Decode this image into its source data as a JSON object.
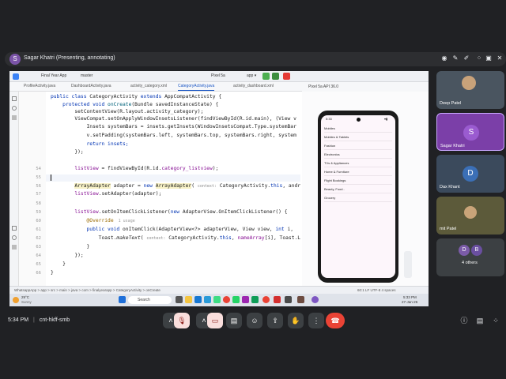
{
  "meet": {
    "presenter_avatar": "S",
    "presenter_label": "Sagar Khatri (Presenting, annotating)",
    "time": "5:34 PM",
    "separator": "|",
    "meeting_code": "cnt-hkff-smb"
  },
  "ide": {
    "tabs": [
      "ProfileActivity.java",
      "DashboardActivity.java",
      "activity_category.xml",
      "CategoryActivity.java",
      "activity_dashboard.xml"
    ],
    "project_label": "Final Year App",
    "run_config": "Pixel 5a",
    "device_tab": "Pixel 5a API 36.0",
    "code_lines": [
      {
        "num": "",
        "text": "public class CategoryActivity extends AppCompatActivity {"
      },
      {
        "num": "",
        "text": "    protected void onCreate(Bundle savedInstanceState) {"
      },
      {
        "num": "",
        "text": "        setContentView(R.layout.activity_category);"
      },
      {
        "num": "",
        "text": "        ViewCompat.setOnApplyWindowInsetsListener(findViewById(R.id.main), (View v"
      },
      {
        "num": "",
        "text": "            Insets systemBars = insets.getInsets(WindowInsetsCompat.Type.systemBar"
      },
      {
        "num": "",
        "text": "            v.setPadding(systemBars.left, systemBars.top, systemBars.right, system"
      },
      {
        "num": "",
        "text": "            return insets;"
      },
      {
        "num": "",
        "text": "        });"
      },
      {
        "num": "",
        "text": ""
      },
      {
        "num": "54",
        "text": "        listView = findViewById(R.id.category_listview);"
      },
      {
        "num": "55",
        "text": ""
      },
      {
        "num": "56",
        "text": "        ArrayAdapter adapter = new ArrayAdapter( context: CategoryActivity.this, andr"
      },
      {
        "num": "57",
        "text": "        listView.setAdapter(adapter);"
      },
      {
        "num": "58",
        "text": ""
      },
      {
        "num": "59",
        "text": "        listView.setOnItemClickListener(new AdapterView.OnItemClickListener() {"
      },
      {
        "num": "60",
        "text": "            @Override  1 usage"
      },
      {
        "num": "61",
        "text": "            public void onItemClick(AdapterView<?> adapterView, View view, int i,"
      },
      {
        "num": "62",
        "text": "                Toast.makeText( context: CategoryActivity.this, nameArray[i], Toast.L"
      },
      {
        "num": "63",
        "text": "            }"
      },
      {
        "num": "64",
        "text": "        });"
      },
      {
        "num": "65",
        "text": "    }"
      },
      {
        "num": "66",
        "text": "}"
      }
    ],
    "breadcrumb": "WhatsappApp > app > src > main > java > com > finalyearapp > CategoryActivity > onCreate",
    "status_right": "60:1  LF  UTF-8  4 spaces",
    "weather_temp": "29°C",
    "weather_text": "Sunny",
    "search_placeholder": "Search",
    "clock_time": "5:33 PM",
    "clock_date": "27-Jan-26"
  },
  "phone": {
    "time": "5:33",
    "items": [
      "Mobiles",
      "Mobiles & Tablets",
      "Fashion",
      "Electronics",
      "TVs & Appliances",
      "Home & Furniture",
      "Flight Bookings",
      "Beauty, Food..",
      "Grocery"
    ]
  },
  "participants": [
    {
      "name": "Deep Patel",
      "avatar": "",
      "color": "#5a7a8c"
    },
    {
      "name": "Sagar Khatri",
      "avatar": "S",
      "color": "#7b3fa8"
    },
    {
      "name": "Dax Khant",
      "avatar": "D",
      "color": "#3b6fb6"
    },
    {
      "name": "mit Patel",
      "avatar": "",
      "color": "#6b6a3a"
    }
  ],
  "others": {
    "avatars": [
      "D",
      "B"
    ],
    "label": "4 others"
  },
  "controls": [
    "mic-off",
    "camera-off",
    "captions",
    "emoji",
    "present",
    "raise-hand",
    "more",
    "leave"
  ],
  "colors": {
    "accent": "#1a56c4",
    "leave": "#ea4335",
    "muted_bg": "#f9dedc"
  }
}
